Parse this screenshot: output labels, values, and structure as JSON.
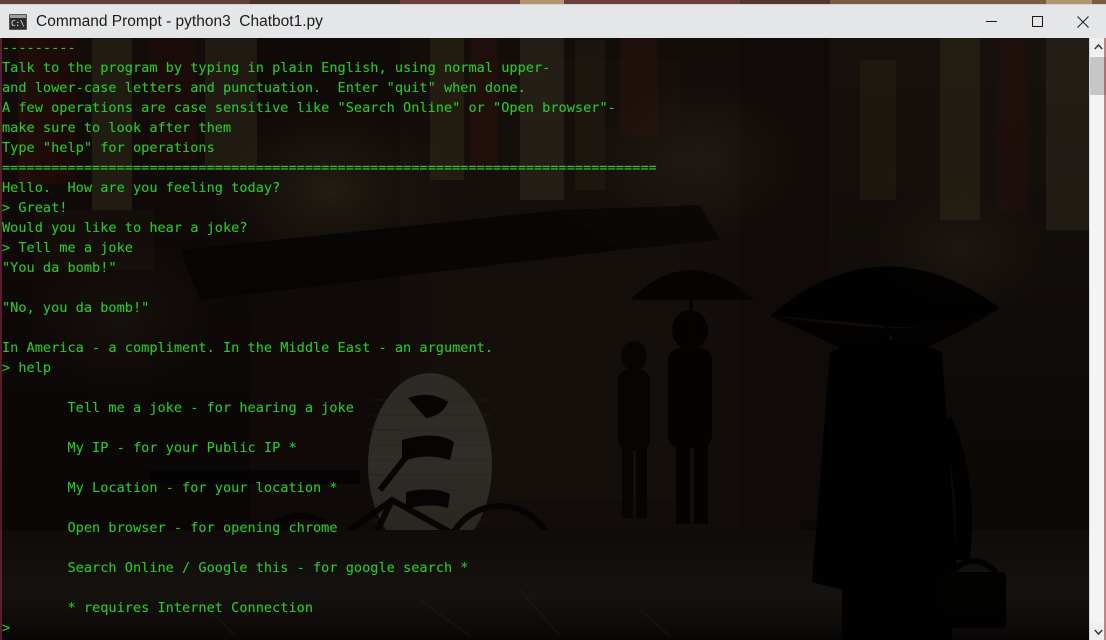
{
  "window": {
    "title": "Command Prompt - python3  Chatbot1.py",
    "icon_name": "cmd-icon",
    "icon_text": "C:\\.",
    "minimize_label": "Minimize",
    "maximize_label": "Maximize",
    "close_label": "Close"
  },
  "theme": {
    "text_color": "#2fc62c",
    "titlebar_bg": "#e4e6e8",
    "terminal_bg": "#000000",
    "scrollbar_bg": "#efefef",
    "scrollbar_thumb": "#c6c6c6"
  },
  "scrollbar": {
    "up_arrow_name": "scroll-up-arrow",
    "down_arrow_name": "scroll-down-arrow",
    "thumb_name": "scrollbar-thumb"
  },
  "terminal": {
    "lines": [
      "---------",
      "Talk to the program by typing in plain English, using normal upper-",
      "and lower-case letters and punctuation.  Enter \"quit\" when done.",
      "A few operations are case sensitive like \"Search Online\" or \"Open browser\"-",
      "make sure to look after them",
      "Type \"help\" for operations",
      "================================================================================",
      "Hello.  How are you feeling today?",
      "> Great!",
      "Would you like to hear a joke?",
      "> Tell me a joke",
      "\"You da bomb!\"",
      "",
      "\"No, you da bomb!\"",
      "",
      "In America - a compliment. In the Middle East - an argument.",
      "> help",
      "",
      "        Tell me a joke - for hearing a joke",
      "",
      "        My IP - for your Public IP *",
      "",
      "        My Location - for your location *",
      "",
      "        Open browser - for opening chrome",
      "",
      "        Search Online / Google this - for google search *",
      "",
      "        * requires Internet Connection",
      ">"
    ]
  }
}
